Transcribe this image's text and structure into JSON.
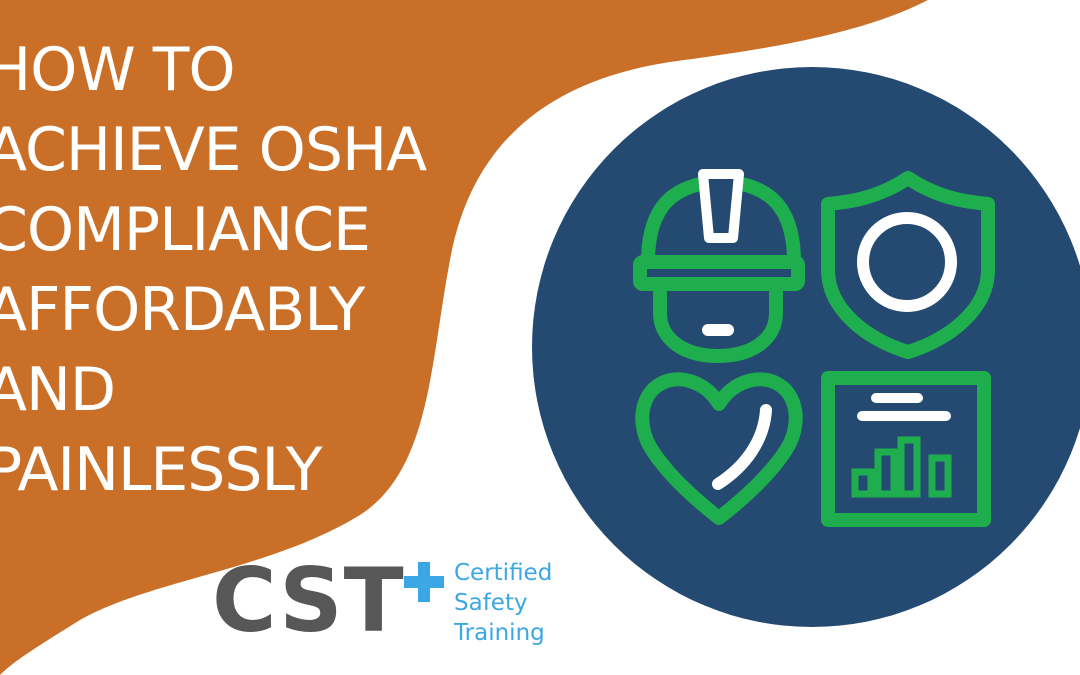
{
  "headline": {
    "lines": [
      "HOW TO",
      "ACHIEVE OSHA",
      "COMPLIANCE",
      "AFFORDABLY",
      "AND",
      "PAINLESSLY"
    ]
  },
  "logo": {
    "letters": "CST",
    "words": [
      "Certified",
      "Safety",
      "Training"
    ]
  },
  "icons": [
    "hard-hat-worker-icon",
    "shield-icon",
    "heart-icon",
    "report-chart-icon"
  ],
  "colors": {
    "orange": "#c96f27",
    "circle_navy": "#244a72",
    "icon_green": "#1fae4d",
    "logo_gray": "#575757",
    "logo_blue": "#3ba7e5",
    "background": "#ffffff"
  }
}
